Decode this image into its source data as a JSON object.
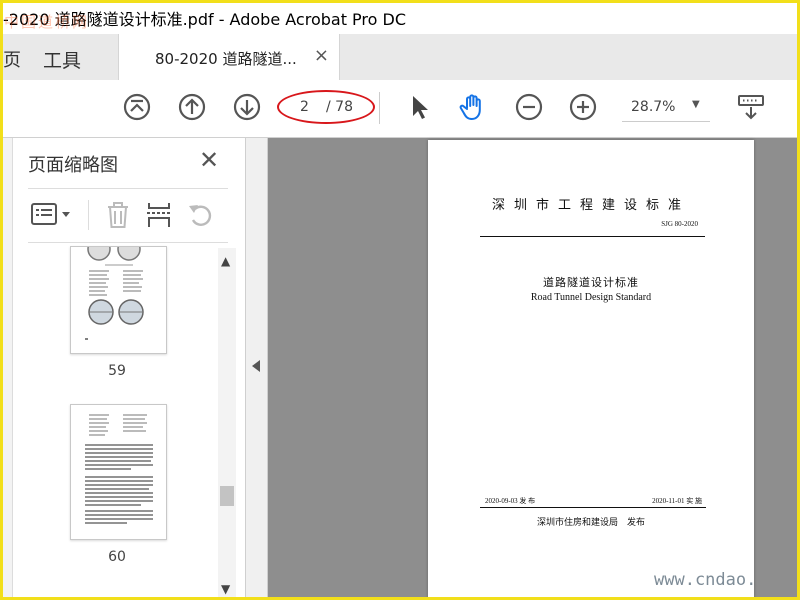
{
  "window": {
    "title": "-2020 道路隧道设计标准.pdf - Adobe Acrobat Pro DC",
    "watermark_top": "中国道桥网"
  },
  "tabs": {
    "home_partial": "页",
    "tools": "工具",
    "document": "80-2020 道路隧道...",
    "close": "×"
  },
  "toolbar": {
    "current_page": "2",
    "total_pages": "/ 78",
    "zoom": "28.7%",
    "zoom_arrow": "▼",
    "accent": "#1473e6",
    "annotation_color": "#d8171b"
  },
  "sidebar": {
    "title": "页面缩略图",
    "close": "✕",
    "thumbnails": [
      {
        "page": "59"
      },
      {
        "page": "60"
      }
    ],
    "scroll_up": "▲",
    "scroll_down": "▼"
  },
  "document": {
    "standard_title": "深圳市工程建设标准",
    "standard_code": "SJG 80-2020",
    "cn_title": "道路隧道设计标准",
    "en_title": "Road Tunnel Design Standard",
    "issue_date": "2020-09-03 发 布",
    "implement_date": "2020-11-01 实 施",
    "publisher": "深圳市住房和建设局　发布"
  },
  "watermark_bottom": "www.cndao."
}
